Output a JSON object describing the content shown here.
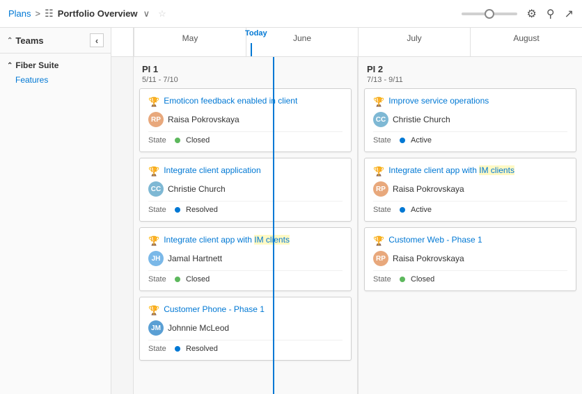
{
  "header": {
    "plans_label": "Plans",
    "separator": ">",
    "grid_icon": "▦",
    "title": "Portfolio Overview",
    "chevron": "∨",
    "star": "☆"
  },
  "sidebar": {
    "teams_label": "Teams",
    "groups": [
      {
        "name": "Fiber Suite",
        "items": [
          "Features"
        ]
      }
    ]
  },
  "timeline": {
    "today_label": "Today",
    "months": [
      "May",
      "June",
      "July",
      "August"
    ]
  },
  "pi1": {
    "title": "PI 1",
    "dates": "5/11 - 7/10",
    "cards": [
      {
        "title": "Emoticon feedback enabled in client",
        "highlight": "",
        "assignee": "Raisa Pokrovskaya",
        "avatar_type": "raisa",
        "avatar_initials": "RP",
        "state": "Closed",
        "state_type": "closed"
      },
      {
        "title": "Integrate client application",
        "highlight": "",
        "assignee": "Christie Church",
        "avatar_type": "christie",
        "avatar_initials": "CC",
        "state": "Resolved",
        "state_type": "resolved"
      },
      {
        "title": "Integrate client app with IM clients",
        "highlight": "IM clients",
        "assignee": "Jamal Hartnett",
        "avatar_type": "jamal",
        "avatar_initials": "JH",
        "state": "Closed",
        "state_type": "closed"
      },
      {
        "title": "Customer Phone - Phase 1",
        "highlight": "",
        "assignee": "Johnnie McLeod",
        "avatar_type": "johnnie",
        "avatar_initials": "JM",
        "state": "Resolved",
        "state_type": "resolved"
      }
    ]
  },
  "pi2": {
    "title": "PI 2",
    "dates": "7/13 - 9/11",
    "cards": [
      {
        "title": "Improve service operations",
        "highlight": "",
        "assignee": "Christie Church",
        "avatar_type": "christie",
        "avatar_initials": "CC",
        "state": "Active",
        "state_type": "active"
      },
      {
        "title": "Integrate client app with IM clients",
        "highlight": "IM clients",
        "assignee": "Raisa Pokrovskaya",
        "avatar_type": "raisa",
        "avatar_initials": "RP",
        "state": "Active",
        "state_type": "active"
      },
      {
        "title": "Customer Web - Phase 1",
        "highlight": "",
        "assignee": "Raisa Pokrovskaya",
        "avatar_type": "raisa",
        "avatar_initials": "RP",
        "state": "Closed",
        "state_type": "closed"
      }
    ]
  }
}
